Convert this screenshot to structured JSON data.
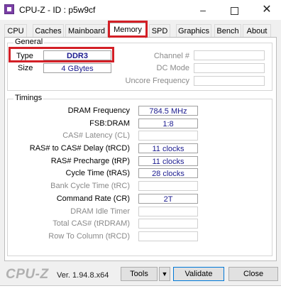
{
  "window": {
    "title": "CPU-Z - ID : p5w9cf"
  },
  "tabs": [
    {
      "label": "CPU"
    },
    {
      "label": "Caches"
    },
    {
      "label": "Mainboard"
    },
    {
      "label": "Memory"
    },
    {
      "label": "SPD"
    },
    {
      "label": "Graphics"
    },
    {
      "label": "Bench"
    },
    {
      "label": "About"
    }
  ],
  "general": {
    "title": "General",
    "type_label": "Type",
    "type_value": "DDR3",
    "size_label": "Size",
    "size_value": "4 GBytes",
    "channel_label": "Channel #",
    "channel_value": "",
    "dc_mode_label": "DC Mode",
    "dc_mode_value": "",
    "uncore_label": "Uncore Frequency",
    "uncore_value": ""
  },
  "timings": {
    "title": "Timings",
    "rows": [
      {
        "label": "DRAM Frequency",
        "value": "784.5 MHz",
        "enabled": true
      },
      {
        "label": "FSB:DRAM",
        "value": "1:8",
        "enabled": true
      },
      {
        "label": "CAS# Latency (CL)",
        "value": "",
        "enabled": false
      },
      {
        "label": "RAS# to CAS# Delay (tRCD)",
        "value": "11 clocks",
        "enabled": true
      },
      {
        "label": "RAS# Precharge (tRP)",
        "value": "11 clocks",
        "enabled": true
      },
      {
        "label": "Cycle Time (tRAS)",
        "value": "28 clocks",
        "enabled": true
      },
      {
        "label": "Bank Cycle Time (tRC)",
        "value": "",
        "enabled": false
      },
      {
        "label": "Command Rate (CR)",
        "value": "2T",
        "enabled": true
      },
      {
        "label": "DRAM Idle Timer",
        "value": "",
        "enabled": false
      },
      {
        "label": "Total CAS# (tRDRAM)",
        "value": "",
        "enabled": false
      },
      {
        "label": "Row To Column (tRCD)",
        "value": "",
        "enabled": false
      }
    ]
  },
  "footer": {
    "brand": "CPU-Z",
    "version": "Ver. 1.94.8.x64",
    "tools_label": "Tools",
    "validate_label": "Validate",
    "close_label": "Close"
  },
  "icons": {
    "minimize": "minimize-icon",
    "maximize": "maximize-icon",
    "close": "close-icon",
    "tools_dropdown": "triangle-down-icon"
  },
  "colors": {
    "value_text": "#1b1b8f",
    "highlight": "#d31f26"
  }
}
